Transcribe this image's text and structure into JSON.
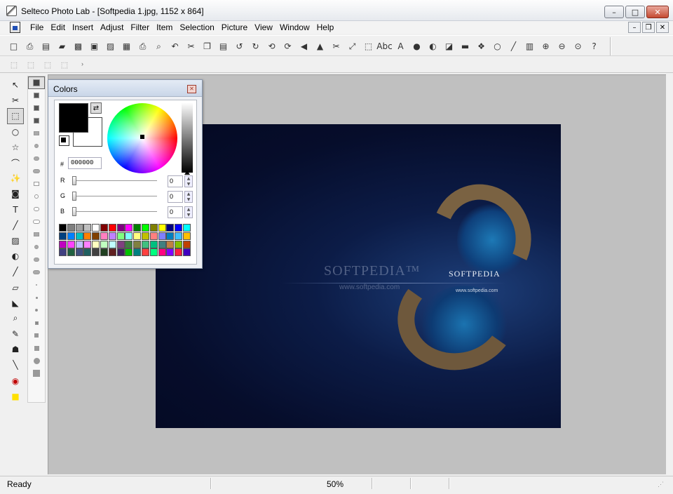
{
  "window": {
    "title": "Selteco Photo Lab - [Softpedia 1.jpg, 1152 x 864]",
    "minimize": "–",
    "maximize": "□",
    "close": "✕"
  },
  "menubar": {
    "items": [
      "File",
      "Edit",
      "Insert",
      "Adjust",
      "Filter",
      "Item",
      "Selection",
      "Picture",
      "View",
      "Window",
      "Help"
    ],
    "mdi_minimize": "–",
    "mdi_restore": "❐",
    "mdi_close": "✕"
  },
  "toolbar": {
    "icons": [
      {
        "name": "new-icon",
        "glyph": "□"
      },
      {
        "name": "print-preview-icon",
        "glyph": "⎙"
      },
      {
        "name": "paste-new-icon",
        "glyph": "▤"
      },
      {
        "name": "open-icon",
        "glyph": "▰"
      },
      {
        "name": "open-recent-icon",
        "glyph": "▩"
      },
      {
        "name": "save-icon",
        "glyph": "▣"
      },
      {
        "name": "save-web-icon",
        "glyph": "▨"
      },
      {
        "name": "export-image-icon",
        "glyph": "▦"
      },
      {
        "name": "print-icon",
        "glyph": "⎙"
      },
      {
        "name": "preview-icon",
        "glyph": "⌕"
      },
      {
        "name": "undo-icon",
        "glyph": "↶"
      },
      {
        "name": "cut-icon",
        "glyph": "✂"
      },
      {
        "name": "copy-icon",
        "glyph": "❐"
      },
      {
        "name": "paste-icon",
        "glyph": "▤"
      },
      {
        "name": "rotate-left-icon",
        "glyph": "↺"
      },
      {
        "name": "rotate-right-icon",
        "glyph": "↻"
      },
      {
        "name": "rotate-180-icon",
        "glyph": "⟲"
      },
      {
        "name": "rotate-custom-icon",
        "glyph": "⟳"
      },
      {
        "name": "flip-horizontal-icon",
        "glyph": "◀"
      },
      {
        "name": "flip-vertical-icon",
        "glyph": "▲"
      },
      {
        "name": "crop-icon",
        "glyph": "✂"
      },
      {
        "name": "fit-icon",
        "glyph": "⤢"
      },
      {
        "name": "resize-icon",
        "glyph": "⬚"
      },
      {
        "name": "text-abc-icon",
        "glyph": "Abc"
      },
      {
        "name": "text-a-icon",
        "glyph": "A"
      },
      {
        "name": "ball-icon",
        "glyph": "●"
      },
      {
        "name": "contrast-icon",
        "glyph": "◐"
      },
      {
        "name": "levels-icon",
        "glyph": "◪"
      },
      {
        "name": "histogram-icon",
        "glyph": "▬"
      },
      {
        "name": "rgb-icon",
        "glyph": "❖"
      },
      {
        "name": "hue-wheel-icon",
        "glyph": "○"
      },
      {
        "name": "pen-line-icon",
        "glyph": "╱"
      },
      {
        "name": "spectrum-icon",
        "glyph": "▥"
      },
      {
        "name": "zoom-in-icon",
        "glyph": "⊕"
      },
      {
        "name": "zoom-out-icon",
        "glyph": "⊖"
      },
      {
        "name": "zoom-actual-icon",
        "glyph": "⊙"
      },
      {
        "name": "help-icon",
        "glyph": "?"
      }
    ],
    "second_row": [
      {
        "name": "select-all-icon",
        "glyph": "⬚"
      },
      {
        "name": "select-none-icon",
        "glyph": "⬚"
      },
      {
        "name": "select-invert-icon",
        "glyph": "⬚"
      },
      {
        "name": "select-edit-icon",
        "glyph": "⬚"
      }
    ],
    "second_row_more": "›"
  },
  "tools": [
    {
      "name": "pointer-tool",
      "glyph": "↖"
    },
    {
      "name": "scissors-tool",
      "glyph": "✂"
    },
    {
      "name": "rect-select-tool",
      "glyph": "⬚",
      "active": true
    },
    {
      "name": "ellipse-select-tool",
      "glyph": "○"
    },
    {
      "name": "polygon-select-tool",
      "glyph": "☆"
    },
    {
      "name": "lasso-tool",
      "glyph": "⌒"
    },
    {
      "name": "magic-wand-tool",
      "glyph": "✨"
    },
    {
      "name": "clone-tool",
      "glyph": "◙"
    },
    {
      "name": "text-tool",
      "glyph": "T"
    },
    {
      "name": "eyedropper-tool",
      "glyph": "╱"
    },
    {
      "name": "gradient-tool",
      "glyph": "▨"
    },
    {
      "name": "shape-tool",
      "glyph": "◐"
    },
    {
      "name": "line-tool",
      "glyph": "╱"
    },
    {
      "name": "eraser-tool",
      "glyph": "▱"
    },
    {
      "name": "fill-tool",
      "glyph": "◣"
    },
    {
      "name": "zoom-tool",
      "glyph": "⌕"
    },
    {
      "name": "pencil-tool",
      "glyph": "✎"
    },
    {
      "name": "stamp-tool",
      "glyph": "☗"
    },
    {
      "name": "ruler-tool",
      "glyph": "╲"
    },
    {
      "name": "red-eye-tool",
      "glyph": "◉"
    },
    {
      "name": "highlight-tool",
      "glyph": "■"
    }
  ],
  "colors_panel": {
    "title": "Colors",
    "close": "✕",
    "swap": "⇄",
    "hex_label": "#",
    "hex_value": "000000",
    "channels": [
      {
        "label": "R",
        "value": "0"
      },
      {
        "label": "G",
        "value": "0"
      },
      {
        "label": "B",
        "value": "0"
      }
    ],
    "spin_up": "▲",
    "spin_down": "▼",
    "swatches": [
      "#000000",
      "#808080",
      "#a0a0a0",
      "#c0c0c0",
      "#ffffff",
      "#800000",
      "#ff0000",
      "#800080",
      "#ff00ff",
      "#008000",
      "#00ff00",
      "#808000",
      "#ffff00",
      "#000080",
      "#0000ff",
      "#00ffff",
      "#004080",
      "#0080ff",
      "#00c0c0",
      "#ff8000",
      "#804000",
      "#ff80c0",
      "#c080ff",
      "#80ff80",
      "#80ffff",
      "#ffff80",
      "#c0c000",
      "#ff8080",
      "#8080ff",
      "#0080c0",
      "#40c0ff",
      "#ffc000",
      "#c000c0",
      "#ff40ff",
      "#c0c0ff",
      "#ff80ff",
      "#ffffc0",
      "#c0ffc0",
      "#c0ffff",
      "#804080",
      "#408040",
      "#808040",
      "#40c080",
      "#00c080",
      "#408080",
      "#c08040",
      "#80c000",
      "#c04000",
      "#404080",
      "#206040",
      "#405080",
      "#206060",
      "#404040",
      "#204020",
      "#602020",
      "#402060",
      "#00c000",
      "#008080",
      "#ff4040",
      "#00ff80",
      "#ff0080",
      "#8000ff",
      "#ff2040",
      "#4000c0"
    ]
  },
  "image": {
    "brand": "SOFTPEDIA",
    "url": "www.softpedia.com",
    "watermark": "SOFTPEDIA™",
    "watermark_url": "www.softpedia.com"
  },
  "status": {
    "text": "Ready",
    "zoom": "50%"
  }
}
